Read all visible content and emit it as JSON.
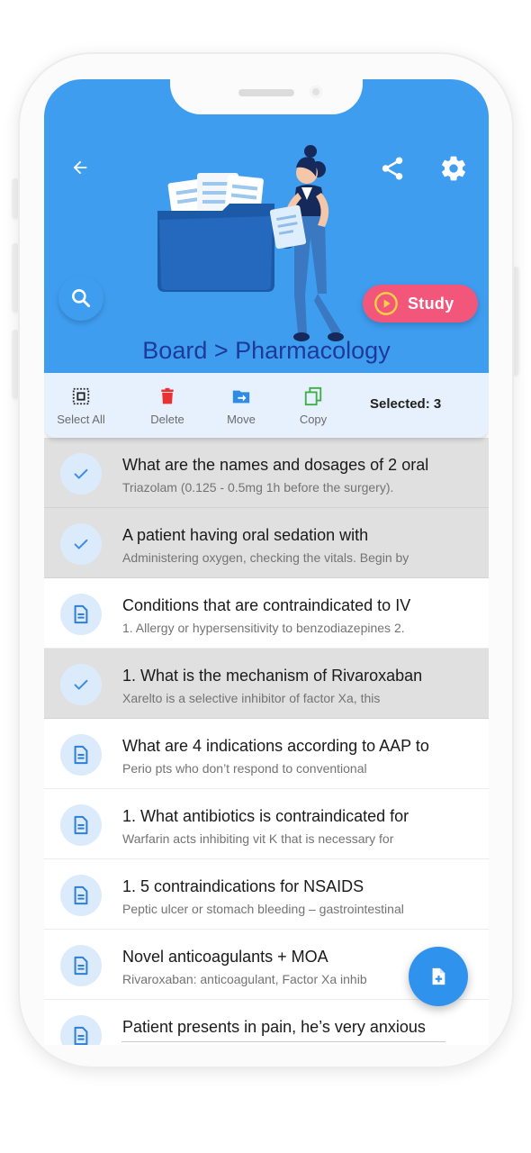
{
  "header": {
    "breadcrumb": "Board > Pharmacology",
    "study_label": "Study"
  },
  "icons": {
    "back": "arrow-left-icon",
    "share": "share-icon",
    "settings": "gear-icon",
    "search": "search-icon",
    "fab": "add-document-icon"
  },
  "colors": {
    "header_bg": "#3f9df0",
    "breadcrumb": "#1e3a98",
    "study_button": "#f2577b",
    "toolbar_bg": "#e6f1fd",
    "delete_red": "#ea3131",
    "move_blue": "#2e8be6",
    "copy_green": "#3cae46",
    "selected_row_bg": "#e0e0e0",
    "fab": "#2f93ee"
  },
  "toolbar": {
    "select_all": "Select All",
    "delete": "Delete",
    "move": "Move",
    "copy": "Copy",
    "selected": "Selected: 3"
  },
  "cards": [
    {
      "title": "What are the names and dosages of 2 oral",
      "subtitle": "Triazolam (0.125 - 0.5mg 1h before the surgery).",
      "selected": true
    },
    {
      "title": "A patient having oral sedation with",
      "subtitle": "Administering oxygen, checking the vitals. Begin by",
      "selected": true
    },
    {
      "title": "Conditions that are contraindicated to IV",
      "subtitle": "1. Allergy or hypersensitivity to benzodiazepines 2.",
      "selected": false
    },
    {
      "title": "1. What is the mechanism of Rivaroxaban",
      "subtitle": "Xarelto is a selective inhibitor of factor Xa, this",
      "selected": true
    },
    {
      "title": "What are 4 indications according to AAP to",
      "subtitle": "Perio pts who don’t respond to conventional",
      "selected": false
    },
    {
      "title": "1. What antibiotics is contraindicated for",
      "subtitle": "Warfarin acts inhibiting vit K that is necessary for",
      "selected": false
    },
    {
      "title": "1. 5 contraindications for NSAIDS",
      "subtitle": "Peptic ulcer or stomach bleeding – gastrointestinal",
      "selected": false
    },
    {
      "title": "Novel anticoagulants + MOA",
      "subtitle": "Rivaroxaban: anticoagulant, Factor Xa inhib",
      "selected": false
    },
    {
      "title": "Patient presents in pain, he’s very anxious",
      "subtitle": "",
      "selected": false
    }
  ]
}
